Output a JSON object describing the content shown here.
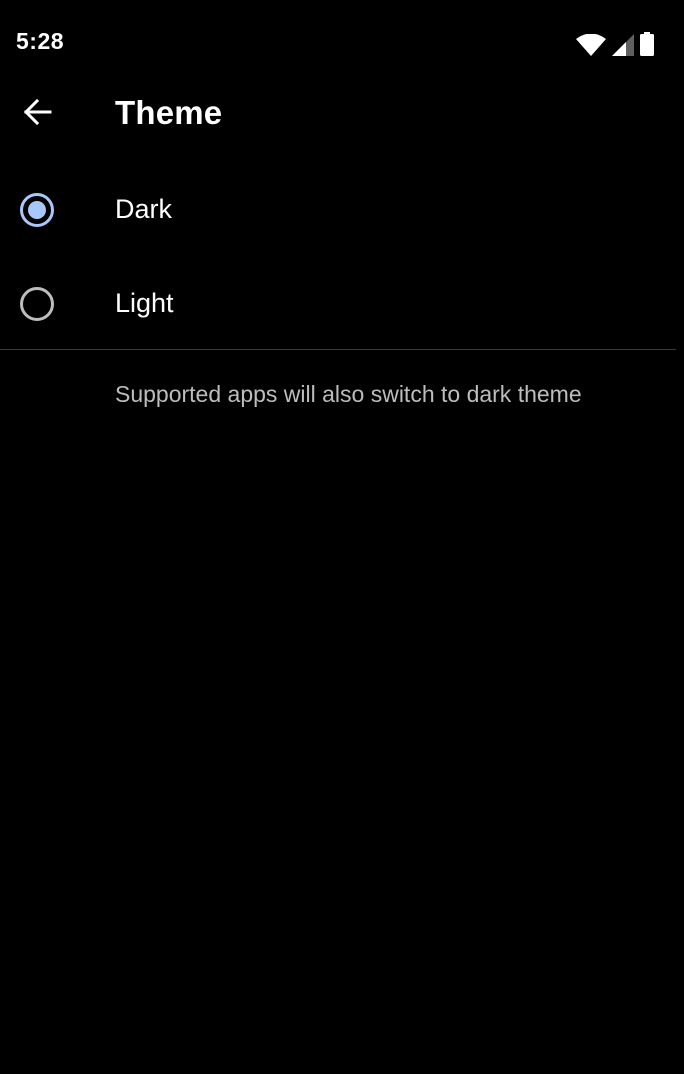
{
  "status_bar": {
    "time": "5:28",
    "icons": [
      "wifi-icon",
      "cellular-signal-icon",
      "battery-icon"
    ]
  },
  "app_bar": {
    "back_icon": "arrow-back-icon",
    "title": "Theme"
  },
  "options": [
    {
      "label": "Dark",
      "selected": true
    },
    {
      "label": "Light",
      "selected": false
    }
  ],
  "footer": {
    "description": "Supported apps will also switch to dark theme"
  },
  "colors": {
    "background": "#000000",
    "accent": "#a8c7fa",
    "text_primary": "#ffffff",
    "text_secondary": "#bdbdbd",
    "divider": "#3a3a3a"
  }
}
